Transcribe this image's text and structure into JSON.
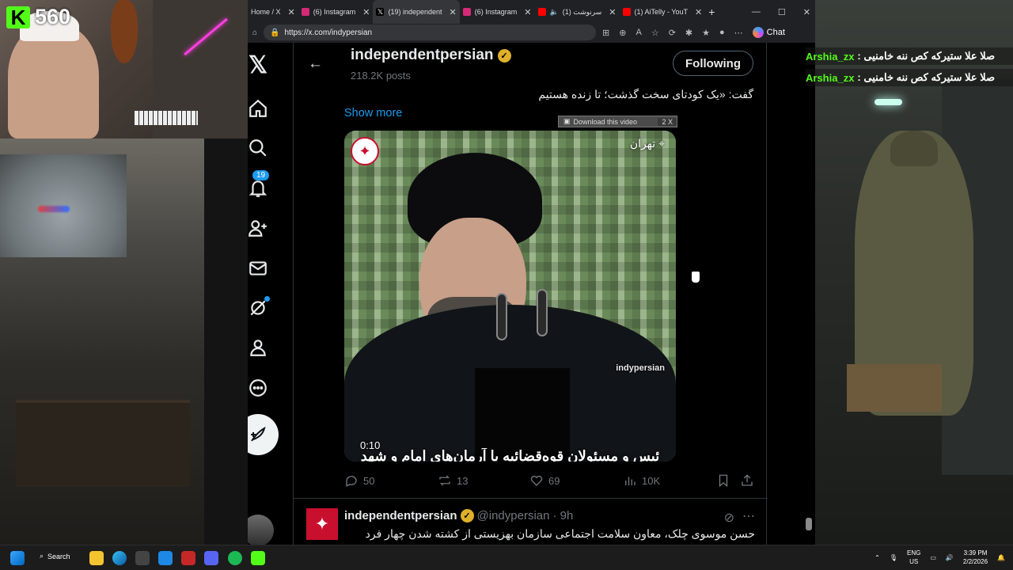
{
  "stream": {
    "kick_letter": "K",
    "viewer_count": "560"
  },
  "browser": {
    "tabs": [
      {
        "label": "Home / X",
        "icon_color": "#000000",
        "active": false
      },
      {
        "label": "(6) Instagram",
        "icon_color": "#d62976",
        "active": false
      },
      {
        "label": "(19) independent",
        "icon_color": "#000000",
        "active": true
      },
      {
        "label": "(6) Instagram",
        "icon_color": "#d62976",
        "active": false
      },
      {
        "label": "(1) سرنوشت",
        "icon_color": "#ff0000",
        "active": false
      },
      {
        "label": "(1) AiTelly - YouT",
        "icon_color": "#ff0000",
        "active": false
      }
    ],
    "new_tab_icon": "plus-icon",
    "url": "https://x.com/indypersian",
    "chat_label": "Chat"
  },
  "nav": {
    "notifications_count": "19"
  },
  "profile": {
    "name": "independentpersian",
    "posts_count": "218.2K posts",
    "follow_label": "Following"
  },
  "tweet": {
    "text_line": "گفت: «یک کودتای سخت گذشت؛ تا زنده هستیم",
    "show_more": "Show more",
    "download_label": "Download this video",
    "download_extra": "2 X",
    "video": {
      "location": "تهران",
      "watermark": "indypersian",
      "time": "0:10",
      "caption": "ئیس و مسئولان قوه‌قضائیه با آرمان‌های امام و شهد"
    },
    "replies": "50",
    "reposts": "13",
    "likes": "69",
    "views": "10K"
  },
  "next_tweet": {
    "name": "independentpersian",
    "handle": "@indypersian",
    "time": "· 9h",
    "text": "حسن موسوی چلک، معاون سلامت اجتماعی سازمان بهزیستی از کشته شدن چهار فرد"
  },
  "chat": [
    {
      "user": "Arshia_zx",
      "message": "صلا علا ستیرکه کص ننه خامنیی :"
    },
    {
      "user": "Arshia_zx",
      "message": "صلا علا ستیرکه کص ننه خامنیی :"
    }
  ],
  "taskbar": {
    "search_label": "Search",
    "lang_top": "ENG",
    "lang_bottom": "US",
    "time": "3:39 PM",
    "date": "2/2/2026"
  }
}
